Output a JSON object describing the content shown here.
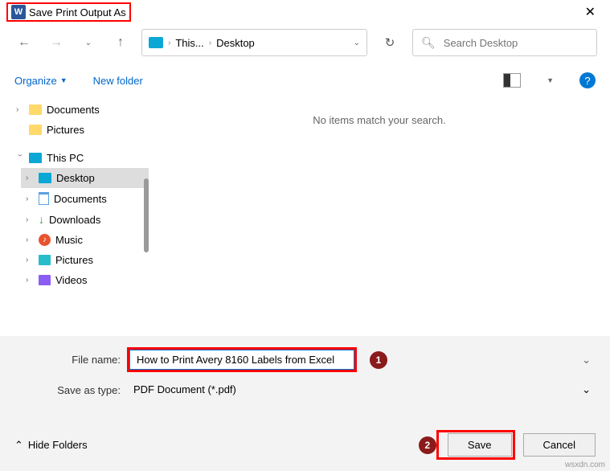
{
  "title": "Save Print Output As",
  "breadcrumb": {
    "part1": "This...",
    "part2": "Desktop"
  },
  "search": {
    "placeholder": "Search Desktop"
  },
  "toolbar": {
    "organize": "Organize",
    "newfolder": "New folder"
  },
  "tree": {
    "quick": [
      {
        "label": "Documents"
      },
      {
        "label": "Pictures"
      }
    ],
    "pc_label": "This PC",
    "pc_items": [
      {
        "label": "Desktop",
        "selected": true
      },
      {
        "label": "Documents"
      },
      {
        "label": "Downloads"
      },
      {
        "label": "Music"
      },
      {
        "label": "Pictures"
      },
      {
        "label": "Videos"
      }
    ]
  },
  "content": {
    "empty_msg": "No items match your search."
  },
  "form": {
    "filename_label": "File name:",
    "filename_value": "How to Print Avery 8160 Labels from Excel",
    "type_label": "Save as type:",
    "type_value": "PDF Document (*.pdf)"
  },
  "callouts": {
    "one": "1",
    "two": "2"
  },
  "footer": {
    "hide": "Hide Folders",
    "save": "Save",
    "cancel": "Cancel"
  },
  "watermark": "wsxdn.com"
}
